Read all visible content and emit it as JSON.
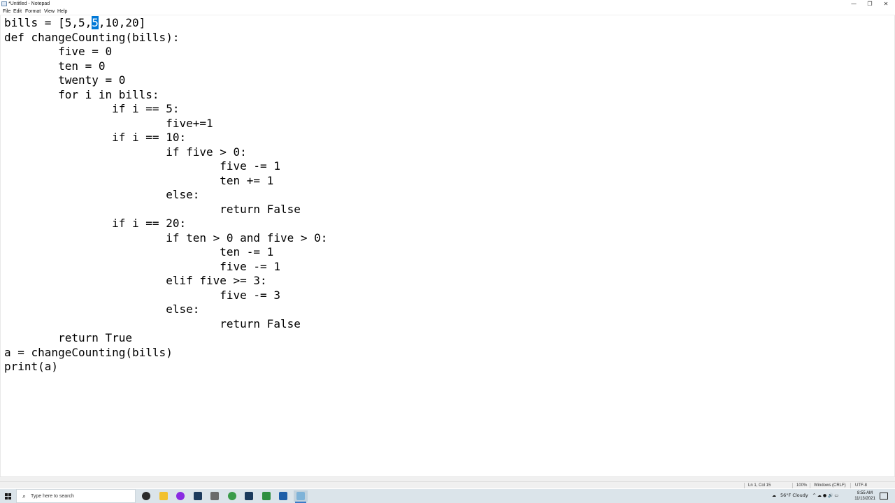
{
  "window": {
    "title": "*Untitled - Notepad",
    "minimize_glyph": "—",
    "maximize_glyph": "❐",
    "close_glyph": "✕"
  },
  "menu": [
    "File",
    "Edit",
    "Format",
    "View",
    "Help"
  ],
  "editor": {
    "selected_text": "5",
    "lines": [
      "bills = [5,5,5,10,20]",
      "def changeCounting(bills):",
      "\tfive = 0",
      "\tten = 0",
      "\ttwenty = 0",
      "\tfor i in bills:",
      "\t\tif i == 5:",
      "\t\t\tfive+=1",
      "\t\tif i == 10:",
      "\t\t\tif five > 0:",
      "\t\t\t\tfive -= 1",
      "\t\t\t\tten += 1",
      "\t\t\telse:",
      "\t\t\t\treturn False",
      "\t\tif i == 20:",
      "\t\t\tif ten > 0 and five > 0:",
      "\t\t\t\tten -= 1",
      "\t\t\t\tfive -= 1",
      "\t\t\telif five >= 3:",
      "\t\t\t\tfive -= 3",
      "\t\t\telse:",
      "\t\t\t\treturn False",
      "\treturn True",
      "a = changeCounting(bills)",
      "print(a)"
    ]
  },
  "status": {
    "position": "Ln 1, Col 15",
    "zoom": "100%",
    "line_ending": "Windows (CRLF)",
    "encoding": "UTF-8"
  },
  "taskbar": {
    "search_placeholder": "Type here to search",
    "apps": [
      {
        "name": "davinci-resolve-icon",
        "color": "#2b2b2b"
      },
      {
        "name": "file-explorer-icon",
        "color": "#f2c12e"
      },
      {
        "name": "cortana-icon",
        "color": "#8a2be2"
      },
      {
        "name": "steam-icon",
        "color": "#1b3a5c"
      },
      {
        "name": "game-controller-icon",
        "color": "#6b6b6b"
      },
      {
        "name": "chrome-icon",
        "color": "#3a9b4a"
      },
      {
        "name": "steam-icon-2",
        "color": "#1b3a5c"
      },
      {
        "name": "spreadsheet-icon",
        "color": "#2f8f3f"
      },
      {
        "name": "powershell-icon",
        "color": "#1f5fa8"
      },
      {
        "name": "notepad-icon",
        "color": "#7fb3d8"
      }
    ],
    "weather": "56°F Cloudy",
    "tray_glyphs": "^  ☁  ●  🔊  ▭",
    "time": "8:55 AM",
    "date": "11/13/2021"
  }
}
